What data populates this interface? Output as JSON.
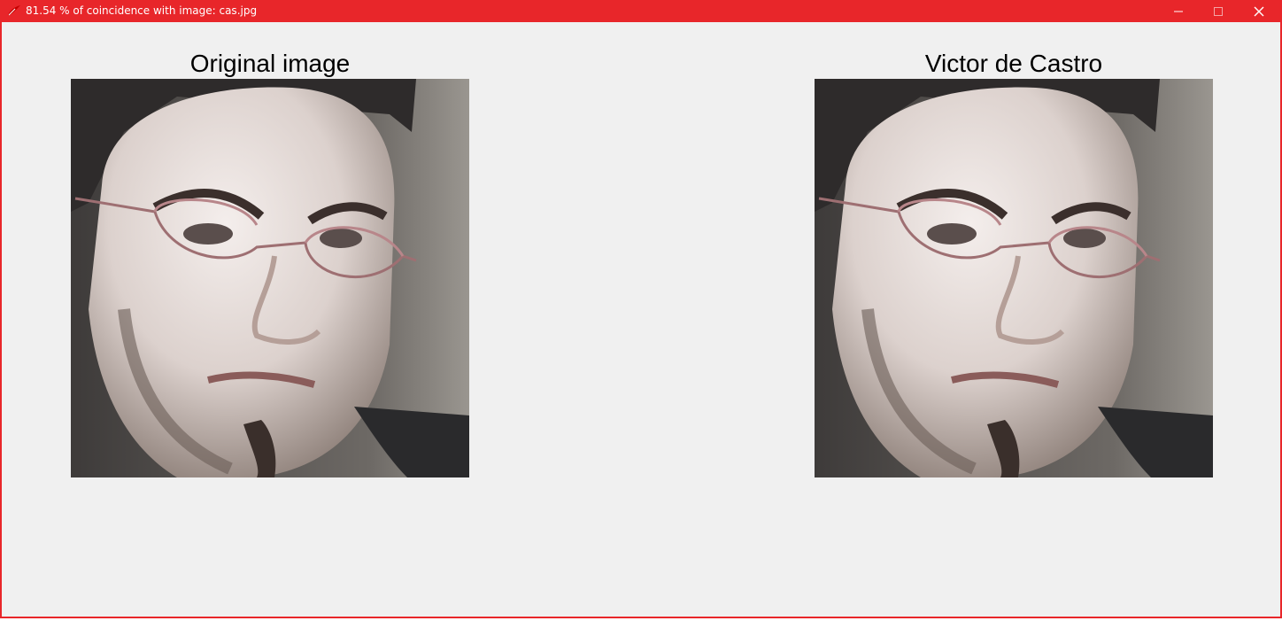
{
  "window": {
    "title": "81.54 % of coincidence with image: cas.jpg",
    "app_icon": "tk-feather-icon",
    "controls": {
      "minimize_icon": "minimize-icon",
      "maximize_icon": "maximize-icon",
      "close_icon": "close-icon"
    },
    "accent_color": "#e8262a"
  },
  "panels": {
    "left": {
      "label": "Original image"
    },
    "right": {
      "label": "Victor de Castro"
    }
  }
}
